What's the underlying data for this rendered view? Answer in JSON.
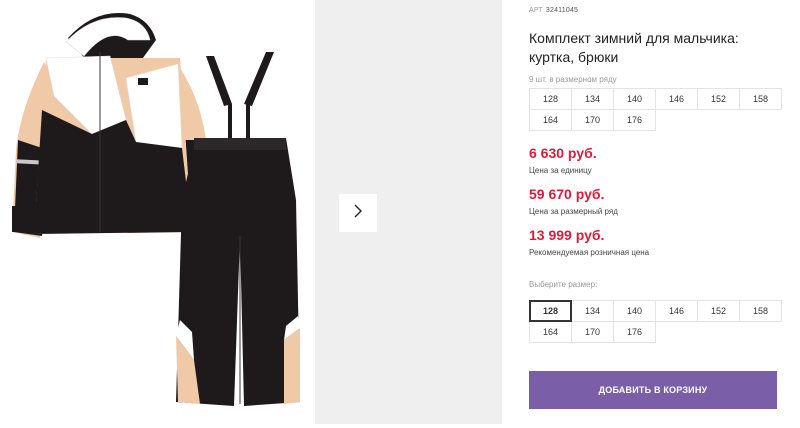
{
  "gallery": {
    "next_icon": "chevron-right-icon",
    "main_image_alt": "jacket-and-pants-photo"
  },
  "product": {
    "article_label": "АРТ",
    "article_code": "32411045",
    "title": "Комплект зимний для мальчика: куртка, брюки",
    "row_note": "9 шт. в размерном ряду",
    "size_row": [
      "128",
      "134",
      "140",
      "146",
      "152",
      "158",
      "164",
      "170",
      "176"
    ],
    "prices": {
      "unit_price": "6 630 руб.",
      "unit_label": "Цена за единицу",
      "row_price": "59 670 руб.",
      "row_label": "Цена за размерный ряд",
      "retail_price": "13 999 руб.",
      "retail_label": "Рекомендуемая розничная цена"
    },
    "choose_label": "Выберите размер:",
    "size_options": [
      "128",
      "134",
      "140",
      "146",
      "152",
      "158",
      "164",
      "170",
      "176"
    ],
    "selected_size": "128",
    "add_to_cart": "ДОБАВИТЬ В КОРЗИНУ"
  },
  "colors": {
    "accent": "#7b5ea8",
    "price": "#e01a3b",
    "jacket_beige": "#f0c9a6",
    "jacket_black": "#1e1a1c"
  }
}
